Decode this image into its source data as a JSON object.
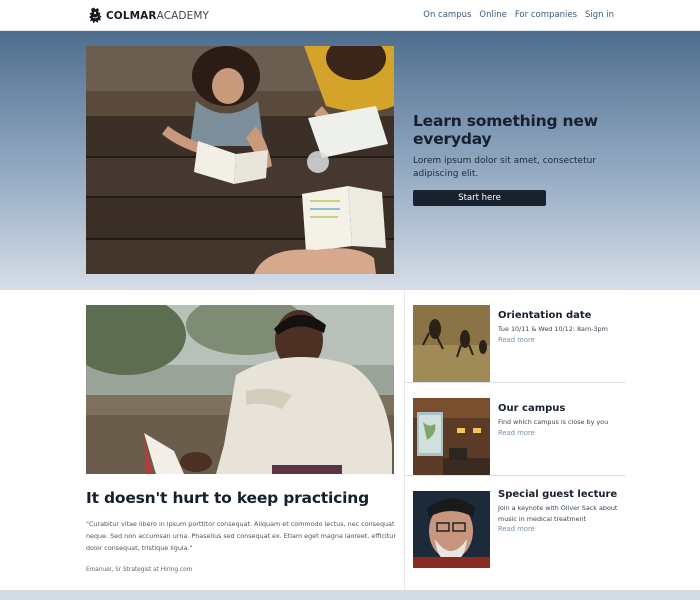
{
  "brand": {
    "name_bold": "COLMAR",
    "name_light": "ACADEMY"
  },
  "nav": {
    "items": [
      "On campus",
      "Online",
      "For companies",
      "Sign in"
    ]
  },
  "hero": {
    "title": "Learn something new everyday",
    "subtitle": "Lorem ipsum dolor sit amet, consectetur adipiscing elit.",
    "button_label": "Start here"
  },
  "feature": {
    "title": "It doesn't hurt to keep practicing",
    "quote": "\"Curabitur vitae libero in ipsum porttitor consequat. Aliquam et commodo lectus, nec consequat neque. Sed non accumsan urna. Phasellus sed consequat ex. Etiam eget magna laoreet, efficitur dolor consequat, tristique ligula.\"",
    "author": "Emanuel, Sr Strategist at Hiring.com"
  },
  "events": [
    {
      "title": "Orientation date",
      "text": "Tue 10/11 & Wed 10/12: 8am-3pm",
      "link": "Read more"
    },
    {
      "title": "Our campus",
      "text": "Find which campus is close by you",
      "link": "Read more"
    },
    {
      "title": "Special guest lecture",
      "text": "Join a keynote with Oliver Sack about music in medical treatment",
      "link": "Read more"
    }
  ],
  "colors": {
    "dark_navy": "#18232f",
    "nav_link": "#3a5a7c",
    "muted_link": "#7b8fa6",
    "hero_top": "#4e6e8e",
    "hero_bottom": "#d5dde7"
  },
  "icons": {
    "logo": "lion-crest-icon"
  }
}
